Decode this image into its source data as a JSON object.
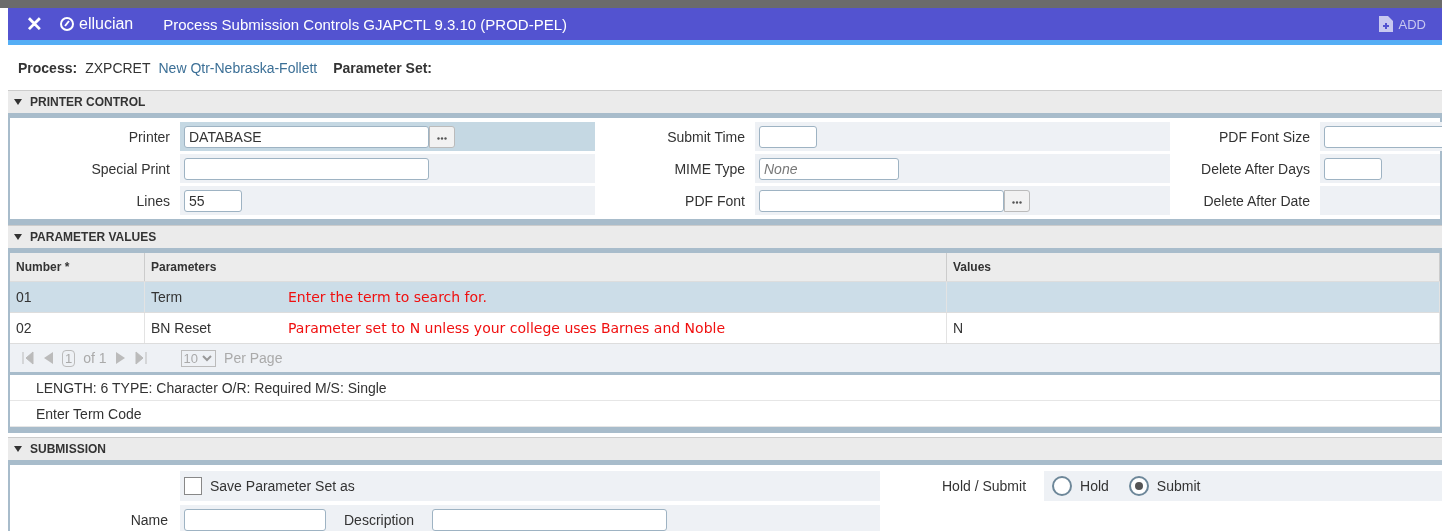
{
  "header": {
    "close": "✕",
    "logo": "ellucian",
    "title": "Process Submission Controls GJAPCTL 9.3.10 (PROD-PEL)",
    "add": "ADD"
  },
  "process": {
    "label": "Process:",
    "code": "ZXPCRET",
    "name": "New Qtr-Nebraska-Follett",
    "set_label": "Parameter Set:"
  },
  "printer_control": {
    "title": "PRINTER CONTROL",
    "expanded": true,
    "columns": [
      [
        {
          "label": "Printer",
          "value": "DATABASE",
          "kind": "lookup",
          "selected": true
        },
        {
          "label": "Special Print",
          "kind": "wide",
          "selected": false
        },
        {
          "label": "Lines",
          "value": "55",
          "kind": "short",
          "selected": false
        }
      ],
      [
        {
          "label": "Submit Time",
          "kind": "short",
          "selected": false
        },
        {
          "label": "MIME Type",
          "placeholder": "None",
          "kind": "medium",
          "selected": false
        },
        {
          "label": "PDF Font",
          "kind": "lookup",
          "selected": false
        }
      ],
      [
        {
          "label": "PDF Font Size",
          "kind": "medium",
          "selected": false
        },
        {
          "label": "Delete After Days",
          "kind": "short",
          "selected": false
        },
        {
          "label": "Delete After Date",
          "kind": "none",
          "selected": false
        }
      ]
    ]
  },
  "parameter_values": {
    "title": "PARAMETER VALUES",
    "expanded": true,
    "columns": [
      "Number *",
      "Parameters",
      "Values"
    ],
    "rows": [
      {
        "number": "01",
        "parameter": "Term",
        "note": "Enter the term to search for.",
        "value": "",
        "selected": true
      },
      {
        "number": "02",
        "parameter": "BN Reset",
        "note": "Parameter set to N unless your college uses Barnes and Noble",
        "value": "N",
        "selected": false
      }
    ],
    "pager": {
      "page": "1",
      "of": "of 1",
      "per_page": "10",
      "per_page_label": "Per Page"
    },
    "info": [
      "LENGTH: 6 TYPE: Character O/R: Required M/S: Single",
      "Enter Term Code"
    ]
  },
  "submission": {
    "title": "SUBMISSION",
    "expanded": true,
    "save": {
      "label": "Save Parameter Set as",
      "checked": false
    },
    "hold_label": "Hold / Submit",
    "options": [
      {
        "label": "Hold",
        "selected": false
      },
      {
        "label": "Submit",
        "selected": true
      }
    ],
    "name_label": "Name",
    "description_label": "Description"
  }
}
